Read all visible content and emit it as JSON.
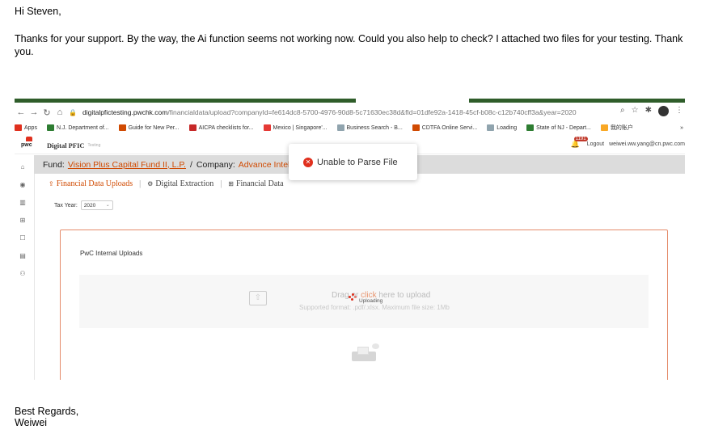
{
  "email": {
    "greeting": "Hi Steven,",
    "body": "Thanks for your support. By the way, the Ai function seems not working now. Could you also help to check? I attached two files for your testing. Thank you.",
    "signoff": "Best Regards,",
    "signature": "Weiwei"
  },
  "browser": {
    "url_host": "digitalpfictesting.pwchk.com",
    "url_path": "/financialdata/upload?companyId=fe614dc8-5700-4976-90d8-5c71630ec38d&fId=01dfe92a-1418-45cf-b08c-c12b740cff3a&year=2020",
    "bookmarks": [
      {
        "label": "Apps",
        "color": "#e0301e"
      },
      {
        "label": "N.J. Department of...",
        "color": "#2e7d32"
      },
      {
        "label": "Guide for New Per...",
        "color": "#d04a02"
      },
      {
        "label": "AICPA checklists for...",
        "color": "#c62828"
      },
      {
        "label": "Mexico | Singapore'...",
        "color": "#e53935"
      },
      {
        "label": "Business Search - B...",
        "color": "#90a4ae"
      },
      {
        "label": "CDTFA Online Servi...",
        "color": "#d04a02"
      },
      {
        "label": "Loading",
        "color": "#90a4ae"
      },
      {
        "label": "State of NJ - Depart...",
        "color": "#2e7d32"
      },
      {
        "label": "我的账户",
        "color": "#f9a825"
      }
    ],
    "more_bookmarks": "»"
  },
  "app": {
    "logo_text": "pwc",
    "title": "Digital PFIC",
    "env_tag": "Testing",
    "notification_count": "1191",
    "logout_label": "Logout",
    "user_email": "weiwei.ww.yang@cn.pwc.com"
  },
  "fundbar": {
    "fund_label": "Fund:",
    "fund_name": "Vision Plus Capital Fund II, L.P.",
    "separator": "/",
    "company_label": "Company:",
    "company_name": "Advance Intel"
  },
  "toast": {
    "message": "Unable to Parse File"
  },
  "tabs": [
    {
      "label": "Financial Data Uploads",
      "icon": "upload-icon",
      "active": true
    },
    {
      "label": "Digital Extraction",
      "icon": "extraction-icon",
      "active": false
    },
    {
      "label": "Financial Data",
      "icon": "table-icon",
      "active": false
    }
  ],
  "tax_year": {
    "label": "Tax Year:",
    "value": "2020"
  },
  "upload": {
    "panel_title": "PwC Internal Uploads",
    "drop_prefix": "Drag or ",
    "drop_link": "click",
    "drop_suffix": " here to upload",
    "supported": "Supported format: .pdf/.xlsx. Maximum file size: 1Mb",
    "uploading": "Uploading"
  }
}
